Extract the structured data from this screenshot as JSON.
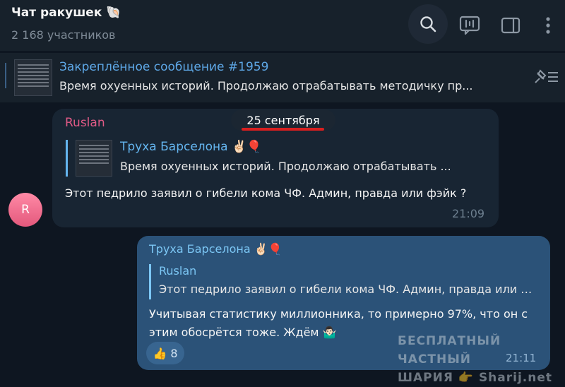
{
  "header": {
    "title": "Чат ракушек",
    "title_emoji": "🐚",
    "subtitle": "2 168 участников",
    "icons": [
      "search-icon",
      "live-stream-icon",
      "sidebar-toggle-icon",
      "more-vert-icon"
    ]
  },
  "pinned": {
    "title": "Закреплённое сообщение #1959",
    "text": "Время охуенных историй.  Продолжаю отрабатывать методичку пр..."
  },
  "date_divider": "25 сентября",
  "messages": [
    {
      "sender": "Ruslan",
      "avatar_letter": "R",
      "reply": {
        "name": "Труха Барселона ✌🏻🎈",
        "text": "Время охуенных историй.  Продолжаю отрабатывать ..."
      },
      "text": "Этот педрило заявил о гибели кома ЧФ. Админ, правда или фэйк ?",
      "time": "21:09"
    },
    {
      "sender": "Труха Барселона ✌🏻🎈",
      "reply": {
        "name": "Ruslan",
        "text": "Этот педрило заявил о гибели кома ЧФ. Админ, правда или ф..."
      },
      "text": "Учитывая статистику миллионника, то  примерно 97%, что он с этим обосрётся тоже. Ждём 🤷🏻‍♂️",
      "reaction_emoji": "👍",
      "reaction_count": "8",
      "time": "21:11"
    }
  ],
  "watermark": {
    "line1": "БЕСПЛАТНЫЙ  ЧАСТНЫЙ",
    "line2": "ШАРИЯ 👉 Sharij.net"
  },
  "colors": {
    "background": "#0e1621",
    "header": "#17212b",
    "incoming_bubble": "#182533",
    "outgoing_bubble": "#2b5278",
    "link": "#5ea8e7",
    "sender_ruslan": "#e05a86",
    "date_underline": "#d81f1f"
  }
}
